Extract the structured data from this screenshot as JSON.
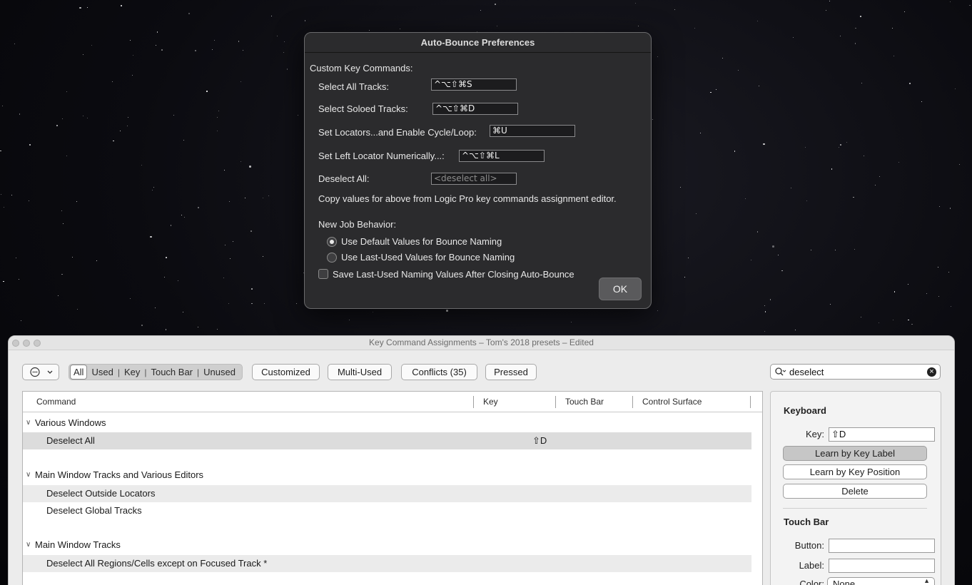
{
  "dialog": {
    "title": "Auto-Bounce Preferences",
    "section_label": "Custom Key Commands:",
    "fields": [
      {
        "label": "Select All Tracks:",
        "value": "^⌥⇧⌘S"
      },
      {
        "label": "Select Soloed Tracks:",
        "value": "^⌥⇧⌘D"
      },
      {
        "label": "Set Locators...and Enable Cycle/Loop:",
        "value": "⌘U"
      },
      {
        "label": "Set Left Locator Numerically...:",
        "value": "^⌥⇧⌘L"
      },
      {
        "label": "Deselect All:",
        "placeholder": "<deselect all>"
      }
    ],
    "hint": "Copy values for above from Logic Pro key commands assignment editor.",
    "new_job_label": "New Job Behavior:",
    "radio_default": "Use Default Values for Bounce Naming",
    "radio_last_used": "Use Last-Used Values for Bounce Naming",
    "checkbox_save": "Save Last-Used Naming Values After Closing Auto-Bounce",
    "ok_label": "OK"
  },
  "key_window": {
    "title": "Key Command Assignments – Tom's 2018 presets – Edited",
    "filters": {
      "segments": [
        "All",
        "Used",
        "Key",
        "Touch Bar",
        "Unused"
      ],
      "customized": "Customized",
      "multi_used": "Multi-Used",
      "conflicts": "Conflicts (35)",
      "pressed": "Pressed"
    },
    "search_value": "deselect",
    "columns": {
      "command": "Command",
      "key": "Key",
      "touch_bar": "Touch Bar",
      "control_surface": "Control Surface"
    },
    "rows": [
      {
        "group": "Various Windows"
      },
      {
        "command": "Deselect All",
        "key": "⇧D"
      },
      {
        "group": "Main Window Tracks and Various Editors"
      },
      {
        "command": "Deselect Outside Locators"
      },
      {
        "command": "Deselect Global Tracks"
      },
      {
        "group": "Main Window Tracks"
      },
      {
        "command": "Deselect All Regions/Cells except on Focused Track *"
      }
    ],
    "inspector": {
      "keyboard_title": "Keyboard",
      "key_label": "Key:",
      "key_value": "⇧D",
      "learn_label_btn": "Learn by Key Label",
      "learn_position_btn": "Learn by Key Position",
      "delete_btn": "Delete",
      "touch_bar_title": "Touch Bar",
      "button_label": "Button:",
      "label_label": "Label:",
      "color_label": "Color:",
      "color_value": "None"
    }
  }
}
